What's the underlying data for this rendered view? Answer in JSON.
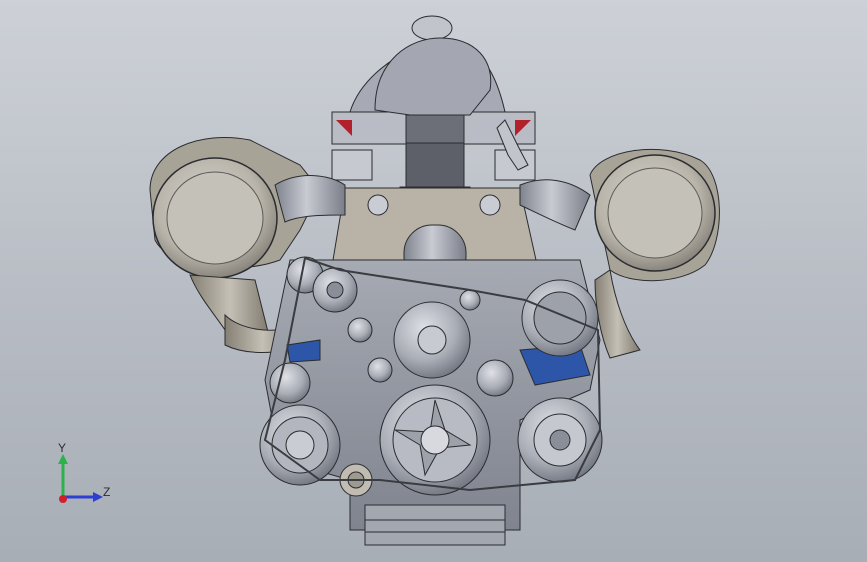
{
  "viewport": {
    "background_top": "#cdd1d7",
    "background_bottom": "#a8aeb6"
  },
  "model": {
    "icon": "engine-assembly-3d-model",
    "colors": {
      "metal": "#9fa3ad",
      "metal_light": "#c4c7cf",
      "metal_dark": "#6c707a",
      "plate": "#b9b2a6",
      "accent_red": "#b2202c",
      "accent_blue": "#2e56a8",
      "edge": "#2a2c30"
    }
  },
  "triad": {
    "y_label": "Y",
    "z_label": "Z",
    "y_color": "#2bb24c",
    "z_color": "#2c3fd1",
    "x_color": "#d0202a"
  }
}
